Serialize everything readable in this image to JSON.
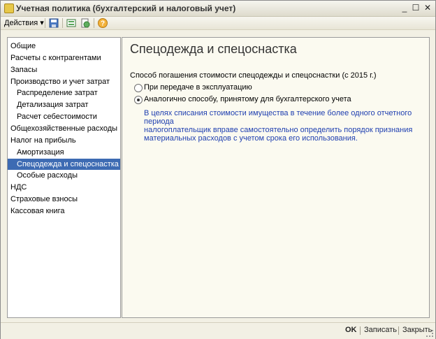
{
  "window": {
    "title": "Учетная политика (бухгалтерский и налоговый учет)",
    "controls": [
      "_",
      "☐",
      "✕"
    ]
  },
  "toolbar": {
    "actions_label": "Действия",
    "dropdown_glyph": "▾",
    "help_glyph": "?"
  },
  "sidebar": {
    "items": [
      {
        "label": "Общие",
        "level": 0
      },
      {
        "label": "Расчеты с контрагентами",
        "level": 0
      },
      {
        "label": "Запасы",
        "level": 0
      },
      {
        "label": "Производство и учет затрат",
        "level": 0
      },
      {
        "label": "Распределение затрат",
        "level": 1
      },
      {
        "label": "Детализация затрат",
        "level": 1
      },
      {
        "label": "Расчет себестоимости",
        "level": 1
      },
      {
        "label": "Общехозяйственные расходы",
        "level": 0
      },
      {
        "label": "Налог на прибыль",
        "level": 0
      },
      {
        "label": "Амортизация",
        "level": 1
      },
      {
        "label": "Спецодежда и спецоснастка",
        "level": 1,
        "selected": true
      },
      {
        "label": "Особые расходы",
        "level": 1
      },
      {
        "label": "НДС",
        "level": 0
      },
      {
        "label": "Страховые взносы",
        "level": 0
      },
      {
        "label": "Кассовая книга",
        "level": 0
      }
    ]
  },
  "main": {
    "title": "Спецодежда и спецоснастка",
    "group_label": "Способ погашения стоимости спецодежды и спецоснастки (с 2015 г.)",
    "options": [
      {
        "label": "При передаче в эксплуатацию",
        "checked": false
      },
      {
        "label": "Аналогично способу, принятому для бухгалтерского учета",
        "checked": true
      }
    ],
    "hint_lines": [
      "В целях списания стоимости имущества в течение более одного отчетного периода",
      "налогоплательщик вправе самостоятельно определить порядок признания",
      "материальных расходов с учетом срока его использования."
    ]
  },
  "footer": {
    "ok_label": "OK",
    "save_label": "Записать",
    "close_label": "Закрыть"
  }
}
